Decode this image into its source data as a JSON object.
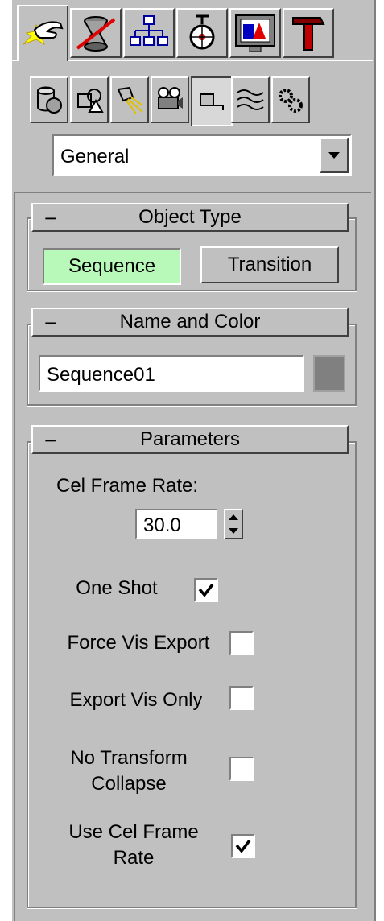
{
  "command_tabs": [
    {
      "name": "create",
      "active": true
    },
    {
      "name": "modify"
    },
    {
      "name": "hierarchy"
    },
    {
      "name": "motion"
    },
    {
      "name": "display"
    },
    {
      "name": "utilities"
    }
  ],
  "category_buttons": [
    "geometry",
    "shapes",
    "lights",
    "cameras",
    "helpers",
    "space-warps",
    "systems"
  ],
  "category_dropdown": {
    "value": "General"
  },
  "object_type": {
    "title": "Object Type",
    "collapse": "−",
    "sequence_label": "Sequence",
    "transition_label": "Transition",
    "active_color": "#b8f8b8"
  },
  "name_and_color": {
    "title": "Name and Color",
    "collapse": "−",
    "name_value": "Sequence01",
    "swatch_color": "#808080"
  },
  "parameters": {
    "title": "Parameters",
    "collapse": "−",
    "cel_frame_rate_label": "Cel Frame Rate:",
    "cel_frame_rate_value": "30.0",
    "one_shot_label": "One Shot",
    "one_shot_checked": true,
    "force_vis_export_label": "Force Vis Export",
    "force_vis_export_checked": false,
    "export_vis_only_label": "Export Vis Only",
    "export_vis_only_checked": false,
    "no_transform_collapse_label_1": "No Transform",
    "no_transform_collapse_label_2": "Collapse",
    "no_transform_collapse_checked": false,
    "use_cel_frame_rate_label_1": "Use Cel Frame",
    "use_cel_frame_rate_label_2": "Rate",
    "use_cel_frame_rate_checked": true
  }
}
